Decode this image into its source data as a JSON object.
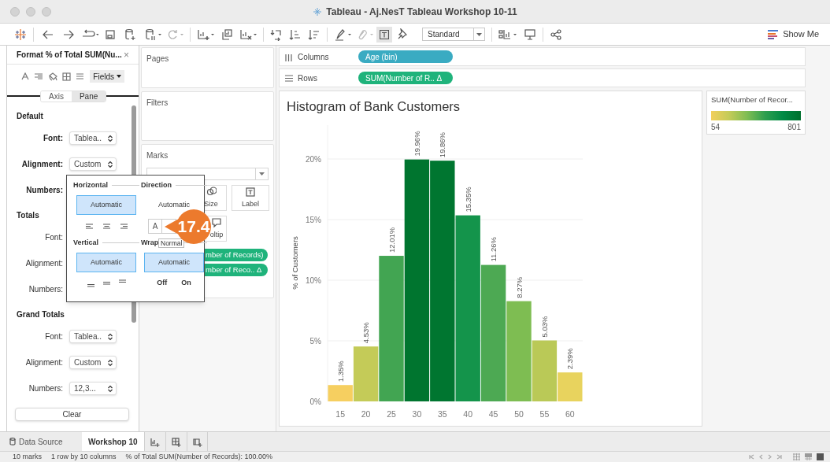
{
  "window": {
    "title": "Tableau - Aj.NesT Tableau Workshop 10-11"
  },
  "toolbar": {
    "fit_dropdown": "Standard",
    "show_me": "Show Me"
  },
  "format_pane": {
    "title": "Format % of Total SUM(Nu...",
    "close": "×",
    "fields_button": "Fields",
    "tabs": [
      {
        "label": "Axis",
        "selected": false
      },
      {
        "label": "Pane",
        "selected": true
      }
    ],
    "sections": [
      {
        "heading": "Default",
        "rows": [
          {
            "label": "Font:",
            "value": "Tablea.."
          },
          {
            "label": "Alignment:",
            "value": "Custom"
          },
          {
            "label": "Numbers:"
          }
        ]
      },
      {
        "heading": "Totals",
        "rows": [
          {
            "label": "Font:"
          },
          {
            "label": "Alignment:"
          },
          {
            "label": "Numbers:"
          }
        ]
      },
      {
        "heading": "Grand Totals",
        "rows": [
          {
            "label": "Font:",
            "value": "Tablea.."
          },
          {
            "label": "Alignment:",
            "value": "Custom"
          },
          {
            "label": "Numbers:",
            "value": "12,3..."
          }
        ]
      }
    ],
    "clear_button": "Clear"
  },
  "cards": {
    "pages": "Pages",
    "filters": "Filters",
    "marks": {
      "title": "Marks",
      "buttons": [
        {
          "label": "Size",
          "kind": "size"
        },
        {
          "label": "Label",
          "kind": "label"
        },
        {
          "label": "oltip",
          "kind": "tooltip"
        }
      ],
      "pills": [
        "mber of Records)",
        "mber of Reco.. Δ"
      ]
    }
  },
  "shelves": [
    {
      "label": "Columns",
      "kind": "columns",
      "pill": "Age (bin)"
    },
    {
      "label": "Rows",
      "kind": "rows",
      "pill": "SUM(Number of R.. Δ"
    }
  ],
  "alignment_popup": {
    "groups": [
      {
        "heading": "Horizontal",
        "option": "Automatic",
        "selected": true
      },
      {
        "heading": "Direction",
        "option": "Automatic",
        "selected": false
      },
      {
        "heading": "Vertical",
        "option": "Automatic",
        "selected": true
      },
      {
        "heading": "Wrap",
        "option": "Automatic",
        "selected": true
      }
    ],
    "direction_letter": "A",
    "wrap_off": "Off",
    "wrap_on": "On",
    "tooltip": "Normal"
  },
  "callout": "17.4",
  "chart": {
    "chart_data": {
      "type": "bar",
      "title": "Histogram of Bank Customers",
      "ylabel": "% of Customers",
      "categories": [
        "15",
        "20",
        "25",
        "30",
        "35",
        "40",
        "45",
        "50",
        "55",
        "60"
      ],
      "grid": true,
      "series": [
        {
          "values": [
            1.35,
            4.53,
            12.01,
            19.96,
            19.86,
            15.35,
            11.26,
            8.27,
            5.03,
            2.39
          ]
        }
      ],
      "ylim": [
        0,
        22.8
      ],
      "yticks": [
        {
          "value": 0,
          "label": "0%"
        },
        {
          "value": 5,
          "label": "5%"
        },
        {
          "value": 10,
          "label": "10%"
        },
        {
          "value": 15,
          "label": "15%"
        },
        {
          "value": 20,
          "label": "20%"
        }
      ],
      "value_labels": [
        "1.35%",
        "4.53%",
        "12.01%",
        "19.96%",
        "19.86%",
        "15.35%",
        "11.26%",
        "8.27%",
        "5.03%",
        "2.39%"
      ]
    }
  },
  "legend": {
    "title": "SUM(Number of Recor...",
    "min": "54",
    "max": "801"
  },
  "sheet_tabs": [
    {
      "label": "Data Source",
      "kind": "datasource",
      "selected": false
    },
    {
      "label": "Workshop 10",
      "kind": "sheet",
      "selected": true
    }
  ],
  "status_bar": [
    "10 marks",
    "1 row by 10 columns",
    "% of Total SUM(Number of Records): 100.00%"
  ]
}
